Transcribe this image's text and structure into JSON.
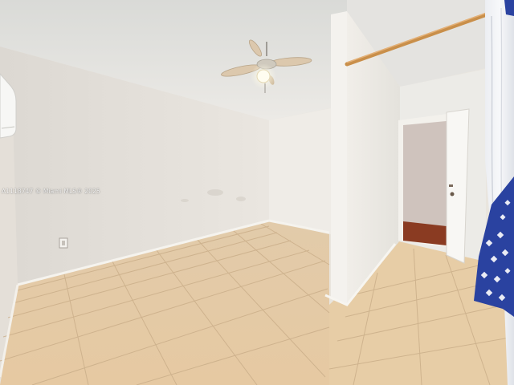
{
  "watermark": {
    "text": "A1118747 © Miami MLS® 2025"
  }
}
